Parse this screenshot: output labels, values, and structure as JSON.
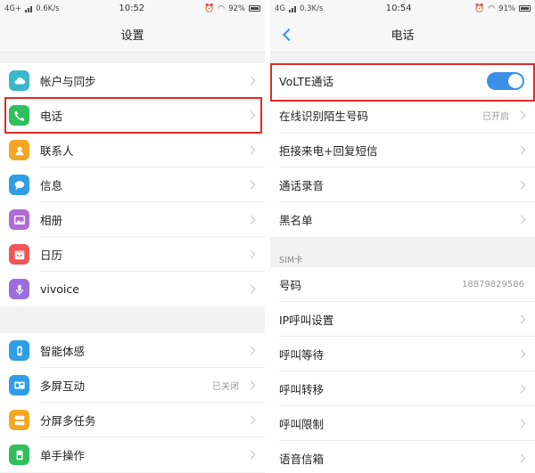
{
  "left": {
    "status": {
      "network": "4G+",
      "speed": "0.6K/s",
      "time": "10:52",
      "battery": "92%"
    },
    "title": "设置",
    "group1": [
      {
        "label": "帐户与同步",
        "icon": "cloud-icon",
        "color": "#39b8c9"
      },
      {
        "label": "电话",
        "icon": "phone-icon",
        "color": "#2fbf5b"
      },
      {
        "label": "联系人",
        "icon": "contacts-icon",
        "color": "#f4a623"
      },
      {
        "label": "信息",
        "icon": "message-icon",
        "color": "#2f9ee8"
      },
      {
        "label": "相册",
        "icon": "gallery-icon",
        "color": "#b06bd8"
      },
      {
        "label": "日历",
        "icon": "calendar-icon",
        "color": "#f05656"
      },
      {
        "label": "vivoice",
        "icon": "mic-icon",
        "color": "#9b6ee0"
      }
    ],
    "group2": [
      {
        "label": "智能体感",
        "icon": "motion-icon",
        "color": "#2f9ee8",
        "value": ""
      },
      {
        "label": "多屏互动",
        "icon": "multiscreen-icon",
        "color": "#2f9ee8",
        "value": "已关闭"
      },
      {
        "label": "分屏多任务",
        "icon": "splitscreen-icon",
        "color": "#f4a623",
        "value": ""
      },
      {
        "label": "单手操作",
        "icon": "one-hand-icon",
        "color": "#2fbf5b",
        "value": ""
      }
    ]
  },
  "right": {
    "status": {
      "network": "4G",
      "speed": "0.3K/s",
      "time": "10:54",
      "battery": "91%"
    },
    "title": "电话",
    "group1": [
      {
        "label": "VoLTE通话",
        "value": ""
      },
      {
        "label": "在线识别陌生号码",
        "value": "已开启"
      },
      {
        "label": "拒接来电+回复短信",
        "value": ""
      },
      {
        "label": "通话录音",
        "value": ""
      },
      {
        "label": "黑名单",
        "value": ""
      }
    ],
    "sim_header": "SIM卡",
    "group2": [
      {
        "label": "号码",
        "value": "18879829586"
      },
      {
        "label": "IP呼叫设置",
        "value": ""
      },
      {
        "label": "呼叫等待",
        "value": ""
      },
      {
        "label": "呼叫转移",
        "value": ""
      },
      {
        "label": "呼叫限制",
        "value": ""
      },
      {
        "label": "语音信箱",
        "value": ""
      }
    ]
  },
  "colors": {
    "accent": "#3a8ee6",
    "highlight": "#e02a2a"
  }
}
